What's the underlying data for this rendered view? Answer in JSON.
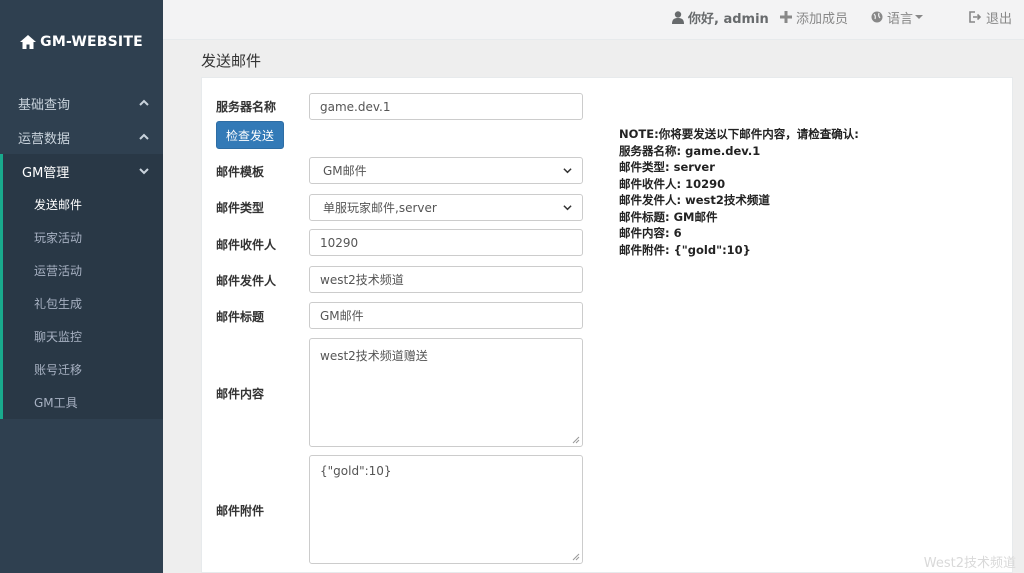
{
  "brand": {
    "name": "GM-WEBSITE"
  },
  "sidebar": {
    "sections": [
      {
        "label": "基础查询"
      },
      {
        "label": "运营数据"
      },
      {
        "label": "GM管理"
      }
    ],
    "sub_items": [
      "发送邮件",
      "玩家活动",
      "运营活动",
      "礼包生成",
      "聊天监控",
      "账号迁移",
      "GM工具"
    ]
  },
  "topbar": {
    "greeting": "你好, admin",
    "add_member": "添加成员",
    "language": "语言",
    "logout": "退出"
  },
  "page": {
    "title": "发送邮件"
  },
  "form": {
    "server_label": "服务器名称",
    "server_value": "game.dev.1",
    "check_button": "检查发送",
    "template_label": "邮件模板",
    "template_value": "GM邮件",
    "type_label": "邮件类型",
    "type_value": "单服玩家邮件,server",
    "recipient_label": "邮件收件人",
    "recipient_value": "10290",
    "sender_label": "邮件发件人",
    "sender_value": "west2技术频道",
    "subject_label": "邮件标题",
    "subject_value": "GM邮件",
    "content_label": "邮件内容",
    "content_value": "west2技术频道赠送",
    "attachment_label": "邮件附件",
    "attachment_value": "{\"gold\":10}"
  },
  "note": {
    "lines": [
      "NOTE:你将要发送以下邮件内容，请检查确认:",
      "服务器名称: game.dev.1",
      "邮件类型: server",
      "邮件收件人: 10290",
      "邮件发件人: west2技术频道",
      "邮件标题: GM邮件",
      "邮件内容: 6",
      "邮件附件: {\"gold\":10}"
    ]
  },
  "watermark": "West2技术频道",
  "colors": {
    "sidebar": "#2f4050",
    "accent": "#19aa8d",
    "primary": "#337ab7"
  }
}
